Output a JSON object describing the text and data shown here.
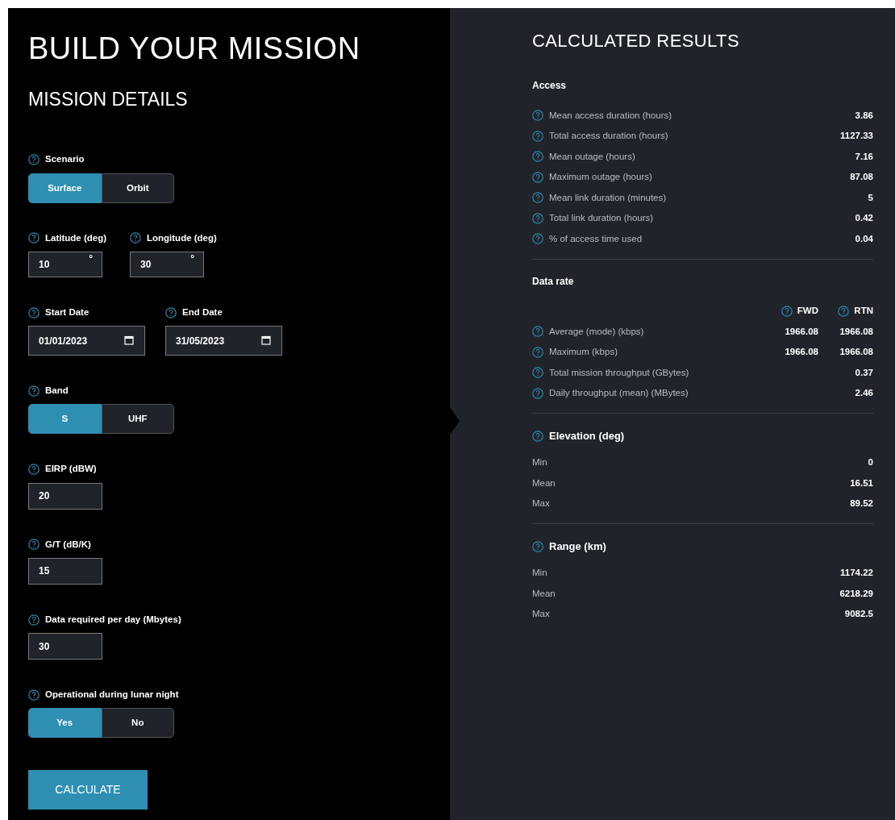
{
  "builder": {
    "title": "BUILD YOUR MISSION",
    "subtitle": "MISSION DETAILS",
    "groups": [
      {
        "controls": [
          {
            "kind": "toggle",
            "label": "Scenario",
            "options": [
              {
                "label": "Surface",
                "selected": true
              },
              {
                "label": "Orbit",
                "selected": false
              }
            ]
          }
        ]
      },
      {
        "controls": [
          {
            "kind": "angle",
            "label": "Latitude (deg)",
            "value": "10",
            "unit": "°"
          },
          {
            "kind": "angle",
            "label": "Longitude (deg)",
            "value": "30",
            "unit": "°"
          }
        ]
      },
      {
        "controls": [
          {
            "kind": "date",
            "label": "Start Date",
            "value": "01/01/2023"
          },
          {
            "kind": "date",
            "label": "End Date",
            "value": "31/05/2023"
          }
        ]
      },
      {
        "controls": [
          {
            "kind": "toggle",
            "label": "Band",
            "options": [
              {
                "label": "S",
                "selected": true
              },
              {
                "label": "UHF",
                "selected": false
              }
            ]
          }
        ]
      },
      {
        "controls": [
          {
            "kind": "number",
            "label": "EIRP (dBW)",
            "value": "20"
          }
        ]
      },
      {
        "controls": [
          {
            "kind": "number",
            "label": "G/T (dB/K)",
            "value": "15"
          }
        ]
      },
      {
        "controls": [
          {
            "kind": "number",
            "label": "Data required per day (Mbytes)",
            "value": "30"
          }
        ]
      },
      {
        "controls": [
          {
            "kind": "toggle",
            "label": "Operational during lunar night",
            "options": [
              {
                "label": "Yes",
                "selected": true
              },
              {
                "label": "No",
                "selected": false
              }
            ]
          }
        ]
      }
    ],
    "calculate": "CALCULATE"
  },
  "results": {
    "title": "CALCULATED RESULTS",
    "sections": [
      {
        "title": "Access",
        "help": false,
        "rows": [
          {
            "label": "Mean access duration (hours)",
            "help": true,
            "values": [
              "3.86"
            ]
          },
          {
            "label": "Total access duration (hours)",
            "help": true,
            "values": [
              "1127.33"
            ]
          },
          {
            "label": "Mean outage (hours)",
            "help": true,
            "values": [
              "7.16"
            ]
          },
          {
            "label": "Maximum outage (hours)",
            "help": true,
            "values": [
              "87.08"
            ]
          },
          {
            "label": "Mean link duration (minutes)",
            "help": true,
            "values": [
              "5"
            ]
          },
          {
            "label": "Total link duration (hours)",
            "help": true,
            "values": [
              "0.42"
            ]
          },
          {
            "label": "% of access time used",
            "help": true,
            "values": [
              "0.04"
            ]
          }
        ]
      },
      {
        "title": "Data rate",
        "help": false,
        "columns": [
          "FWD",
          "RTN"
        ],
        "rows": [
          {
            "label": "Average (mode) (kbps)",
            "help": true,
            "values": [
              "1966.08",
              "1966.08"
            ]
          },
          {
            "label": "Maximum (kbps)",
            "help": true,
            "values": [
              "1966.08",
              "1966.08"
            ]
          },
          {
            "label": "Total mission throughput (GBytes)",
            "help": true,
            "values": [
              "0.37"
            ]
          },
          {
            "label": "Daily throughput (mean) (MBytes)",
            "help": true,
            "values": [
              "2.46"
            ]
          }
        ]
      },
      {
        "title": "Elevation (deg)",
        "help": true,
        "rows": [
          {
            "label": "Min",
            "help": false,
            "values": [
              "0"
            ]
          },
          {
            "label": "Mean",
            "help": false,
            "values": [
              "16.51"
            ]
          },
          {
            "label": "Max",
            "help": false,
            "values": [
              "89.52"
            ]
          }
        ]
      },
      {
        "title": "Range (km)",
        "help": true,
        "rows": [
          {
            "label": "Min",
            "help": false,
            "values": [
              "1174.22"
            ]
          },
          {
            "label": "Mean",
            "help": false,
            "values": [
              "6218.29"
            ]
          },
          {
            "label": "Max",
            "help": false,
            "values": [
              "9082.5"
            ]
          }
        ]
      }
    ]
  }
}
